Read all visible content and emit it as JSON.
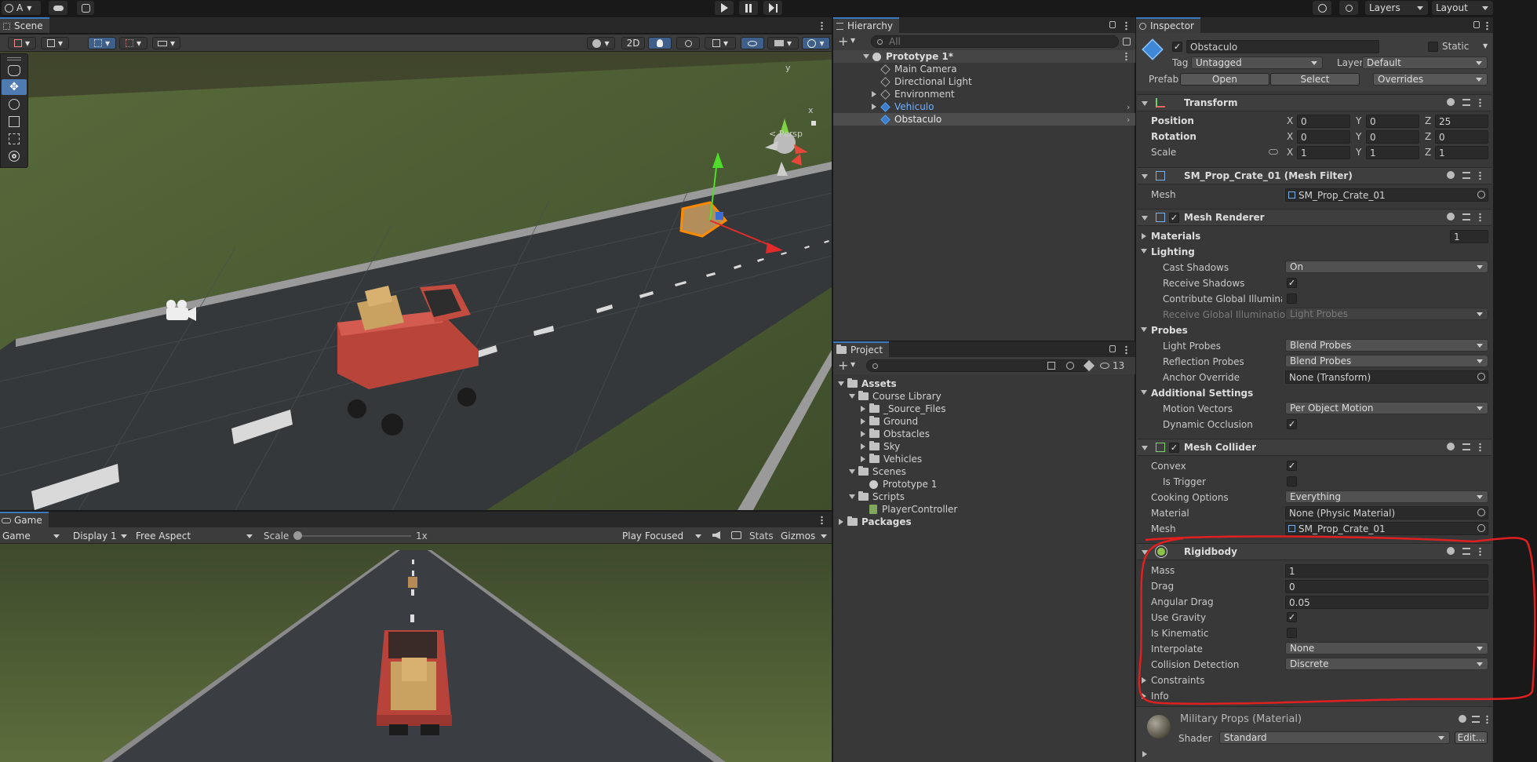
{
  "toolbar": {
    "account": "A",
    "layers": "Layers",
    "layout": "Layout"
  },
  "scene": {
    "tab": "Scene",
    "mode_2d": "2D",
    "persp": "< Persp",
    "gizmo_axes": [
      "y",
      "x"
    ]
  },
  "game": {
    "tab": "Game",
    "view_select": "Game",
    "display": "Display 1",
    "aspect": "Free Aspect",
    "scale_label": "Scale",
    "scale_value": "1x",
    "play_mode": "Play Focused",
    "stats": "Stats",
    "gizmos": "Gizmos"
  },
  "hierarchy": {
    "tab": "Hierarchy",
    "search_placeholder": "All",
    "items": [
      {
        "label": "Prototype 1*"
      },
      {
        "label": "Main Camera"
      },
      {
        "label": "Directional Light"
      },
      {
        "label": "Environment"
      },
      {
        "label": "Vehiculo"
      },
      {
        "label": "Obstaculo"
      }
    ]
  },
  "project": {
    "tab": "Project",
    "hidden_count": "13",
    "tree": [
      {
        "label": "Assets"
      },
      {
        "label": "Course Library"
      },
      {
        "label": "_Source_Files"
      },
      {
        "label": "Ground"
      },
      {
        "label": "Obstacles"
      },
      {
        "label": "Sky"
      },
      {
        "label": "Vehicles"
      },
      {
        "label": "Scenes"
      },
      {
        "label": "Prototype 1"
      },
      {
        "label": "Scripts"
      },
      {
        "label": "PlayerController"
      },
      {
        "label": "Packages"
      }
    ]
  },
  "inspector": {
    "tab": "Inspector",
    "object_name": "Obstaculo",
    "static_label": "Static",
    "tag_label": "Tag",
    "tag_value": "Untagged",
    "layer_label": "Layer",
    "layer_value": "Default",
    "prefab_label": "Prefab",
    "prefab_open": "Open",
    "prefab_select": "Select",
    "prefab_overrides": "Overrides",
    "transform": {
      "title": "Transform",
      "position_label": "Position",
      "rotation_label": "Rotation",
      "scale_label": "Scale",
      "axis_x": "X",
      "axis_y": "Y",
      "axis_z": "Z",
      "position": [
        "0",
        "0",
        "25"
      ],
      "rotation": [
        "0",
        "0",
        "0"
      ],
      "scale": [
        "1",
        "1",
        "1"
      ]
    },
    "mesh_filter": {
      "title": "SM_Prop_Crate_01 (Mesh Filter)",
      "mesh_label": "Mesh",
      "mesh_value": "SM_Prop_Crate_01"
    },
    "mesh_renderer": {
      "title": "Mesh Renderer",
      "materials_label": "Materials",
      "materials_count": "1",
      "lighting_label": "Lighting",
      "cast_shadows_label": "Cast Shadows",
      "cast_shadows_value": "On",
      "receive_shadows_label": "Receive Shadows",
      "contribute_gi_label": "Contribute Global Illuminatic",
      "receive_gi_label": "Receive Global Illumination",
      "receive_gi_value": "Light Probes",
      "probes_label": "Probes",
      "light_probes_label": "Light Probes",
      "light_probes_value": "Blend Probes",
      "reflection_probes_label": "Reflection Probes",
      "reflection_probes_value": "Blend Probes",
      "anchor_override_label": "Anchor Override",
      "anchor_override_value": "None (Transform)",
      "additional_label": "Additional Settings",
      "motion_vectors_label": "Motion Vectors",
      "motion_vectors_value": "Per Object Motion",
      "dynamic_occlusion_label": "Dynamic Occlusion"
    },
    "mesh_collider": {
      "title": "Mesh Collider",
      "convex_label": "Convex",
      "is_trigger_label": "Is Trigger",
      "cooking_label": "Cooking Options",
      "cooking_value": "Everything",
      "material_label": "Material",
      "material_value": "None (Physic Material)",
      "mesh_label": "Mesh",
      "mesh_value": "SM_Prop_Crate_01"
    },
    "rigidbody": {
      "title": "Rigidbody",
      "mass_label": "Mass",
      "mass_value": "1",
      "drag_label": "Drag",
      "drag_value": "0",
      "angular_drag_label": "Angular Drag",
      "angular_drag_value": "0.05",
      "use_gravity_label": "Use Gravity",
      "is_kinematic_label": "Is Kinematic",
      "interpolate_label": "Interpolate",
      "interpolate_value": "None",
      "collision_label": "Collision Detection",
      "collision_value": "Discrete",
      "constraints_label": "Constraints",
      "info_label": "Info"
    },
    "material": {
      "title": "Military Props (Material)",
      "shader_label": "Shader",
      "shader_value": "Standard",
      "edit_label": "Edit..."
    }
  },
  "colors": {
    "accent": "#3a79bb",
    "annotation": "#e02020"
  }
}
